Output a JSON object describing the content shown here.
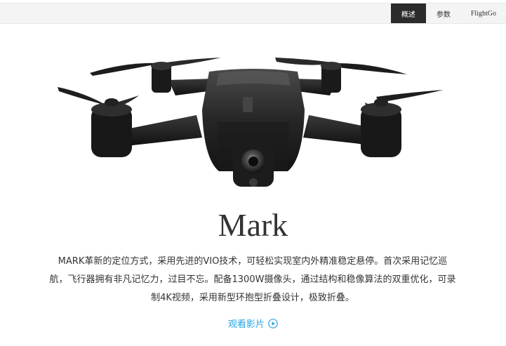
{
  "nav": {
    "tabs": [
      {
        "label": "概述",
        "active": true
      },
      {
        "label": "参数",
        "active": false
      },
      {
        "label": "FlightGo",
        "active": false
      }
    ]
  },
  "hero": {
    "image": "drone-product-photo"
  },
  "product": {
    "title": "Mark",
    "description": "MARK革新的定位方式，采用先进的VIO技术，可轻松实现室内外精准稳定悬停。首次采用记忆巡航，飞行器拥有非凡记忆力，过目不忘。配备1300W摄像头，通过结构和稳像算法的双重优化，可录制4K视频，采用新型环抱型折叠设计，极致折叠。",
    "watch_label": "观看影片",
    "watch_icon": "play-circle-icon"
  },
  "colors": {
    "accent": "#2aa3e0",
    "nav_active_bg": "#2b2b2b",
    "nav_bg": "#f4f4f4"
  }
}
